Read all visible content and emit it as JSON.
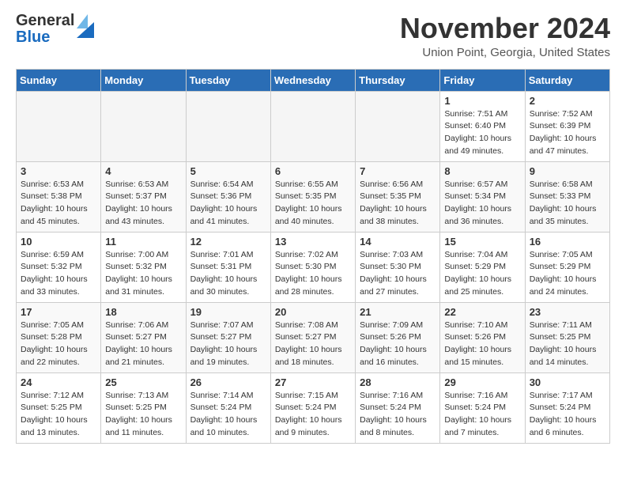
{
  "header": {
    "logo_general": "General",
    "logo_blue": "Blue",
    "month_title": "November 2024",
    "location": "Union Point, Georgia, United States"
  },
  "weekdays": [
    "Sunday",
    "Monday",
    "Tuesday",
    "Wednesday",
    "Thursday",
    "Friday",
    "Saturday"
  ],
  "weeks": [
    [
      {
        "day": "",
        "info": ""
      },
      {
        "day": "",
        "info": ""
      },
      {
        "day": "",
        "info": ""
      },
      {
        "day": "",
        "info": ""
      },
      {
        "day": "",
        "info": ""
      },
      {
        "day": "1",
        "info": "Sunrise: 7:51 AM\nSunset: 6:40 PM\nDaylight: 10 hours\nand 49 minutes."
      },
      {
        "day": "2",
        "info": "Sunrise: 7:52 AM\nSunset: 6:39 PM\nDaylight: 10 hours\nand 47 minutes."
      }
    ],
    [
      {
        "day": "3",
        "info": "Sunrise: 6:53 AM\nSunset: 5:38 PM\nDaylight: 10 hours\nand 45 minutes."
      },
      {
        "day": "4",
        "info": "Sunrise: 6:53 AM\nSunset: 5:37 PM\nDaylight: 10 hours\nand 43 minutes."
      },
      {
        "day": "5",
        "info": "Sunrise: 6:54 AM\nSunset: 5:36 PM\nDaylight: 10 hours\nand 41 minutes."
      },
      {
        "day": "6",
        "info": "Sunrise: 6:55 AM\nSunset: 5:35 PM\nDaylight: 10 hours\nand 40 minutes."
      },
      {
        "day": "7",
        "info": "Sunrise: 6:56 AM\nSunset: 5:35 PM\nDaylight: 10 hours\nand 38 minutes."
      },
      {
        "day": "8",
        "info": "Sunrise: 6:57 AM\nSunset: 5:34 PM\nDaylight: 10 hours\nand 36 minutes."
      },
      {
        "day": "9",
        "info": "Sunrise: 6:58 AM\nSunset: 5:33 PM\nDaylight: 10 hours\nand 35 minutes."
      }
    ],
    [
      {
        "day": "10",
        "info": "Sunrise: 6:59 AM\nSunset: 5:32 PM\nDaylight: 10 hours\nand 33 minutes."
      },
      {
        "day": "11",
        "info": "Sunrise: 7:00 AM\nSunset: 5:32 PM\nDaylight: 10 hours\nand 31 minutes."
      },
      {
        "day": "12",
        "info": "Sunrise: 7:01 AM\nSunset: 5:31 PM\nDaylight: 10 hours\nand 30 minutes."
      },
      {
        "day": "13",
        "info": "Sunrise: 7:02 AM\nSunset: 5:30 PM\nDaylight: 10 hours\nand 28 minutes."
      },
      {
        "day": "14",
        "info": "Sunrise: 7:03 AM\nSunset: 5:30 PM\nDaylight: 10 hours\nand 27 minutes."
      },
      {
        "day": "15",
        "info": "Sunrise: 7:04 AM\nSunset: 5:29 PM\nDaylight: 10 hours\nand 25 minutes."
      },
      {
        "day": "16",
        "info": "Sunrise: 7:05 AM\nSunset: 5:29 PM\nDaylight: 10 hours\nand 24 minutes."
      }
    ],
    [
      {
        "day": "17",
        "info": "Sunrise: 7:05 AM\nSunset: 5:28 PM\nDaylight: 10 hours\nand 22 minutes."
      },
      {
        "day": "18",
        "info": "Sunrise: 7:06 AM\nSunset: 5:27 PM\nDaylight: 10 hours\nand 21 minutes."
      },
      {
        "day": "19",
        "info": "Sunrise: 7:07 AM\nSunset: 5:27 PM\nDaylight: 10 hours\nand 19 minutes."
      },
      {
        "day": "20",
        "info": "Sunrise: 7:08 AM\nSunset: 5:27 PM\nDaylight: 10 hours\nand 18 minutes."
      },
      {
        "day": "21",
        "info": "Sunrise: 7:09 AM\nSunset: 5:26 PM\nDaylight: 10 hours\nand 16 minutes."
      },
      {
        "day": "22",
        "info": "Sunrise: 7:10 AM\nSunset: 5:26 PM\nDaylight: 10 hours\nand 15 minutes."
      },
      {
        "day": "23",
        "info": "Sunrise: 7:11 AM\nSunset: 5:25 PM\nDaylight: 10 hours\nand 14 minutes."
      }
    ],
    [
      {
        "day": "24",
        "info": "Sunrise: 7:12 AM\nSunset: 5:25 PM\nDaylight: 10 hours\nand 13 minutes."
      },
      {
        "day": "25",
        "info": "Sunrise: 7:13 AM\nSunset: 5:25 PM\nDaylight: 10 hours\nand 11 minutes."
      },
      {
        "day": "26",
        "info": "Sunrise: 7:14 AM\nSunset: 5:24 PM\nDaylight: 10 hours\nand 10 minutes."
      },
      {
        "day": "27",
        "info": "Sunrise: 7:15 AM\nSunset: 5:24 PM\nDaylight: 10 hours\nand 9 minutes."
      },
      {
        "day": "28",
        "info": "Sunrise: 7:16 AM\nSunset: 5:24 PM\nDaylight: 10 hours\nand 8 minutes."
      },
      {
        "day": "29",
        "info": "Sunrise: 7:16 AM\nSunset: 5:24 PM\nDaylight: 10 hours\nand 7 minutes."
      },
      {
        "day": "30",
        "info": "Sunrise: 7:17 AM\nSunset: 5:24 PM\nDaylight: 10 hours\nand 6 minutes."
      }
    ]
  ]
}
